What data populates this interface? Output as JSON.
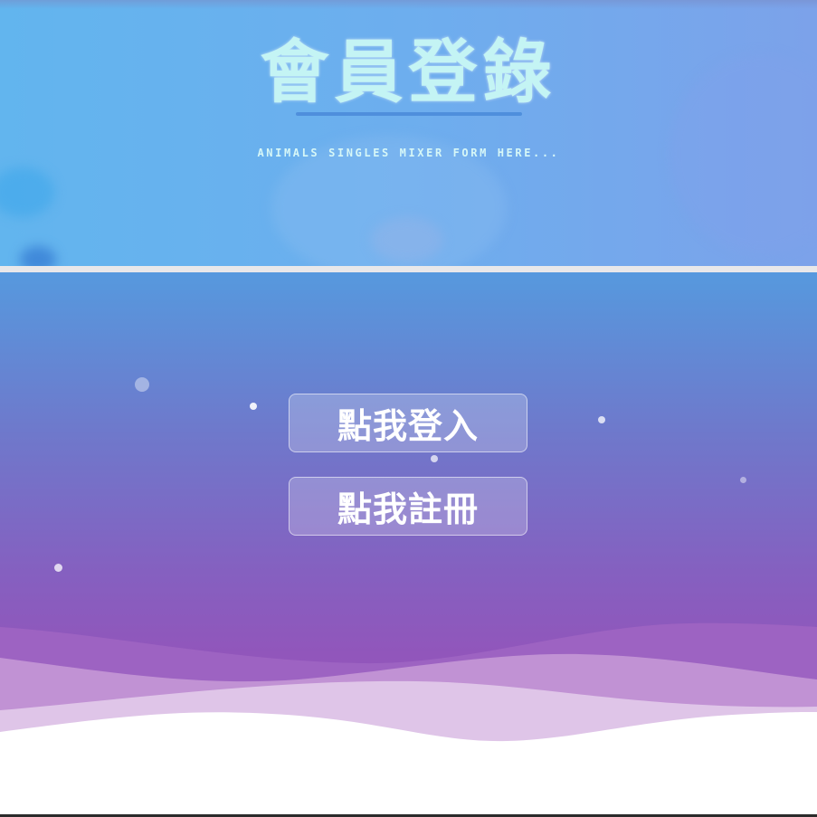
{
  "header": {
    "title": "會員登錄",
    "subtitle": "Animals Singles Mixer Form Here..."
  },
  "actions": {
    "login_label": "點我登入",
    "register_label": "點我註冊"
  },
  "colors": {
    "header_start": "#62b5ee",
    "header_end": "#7ca2ea",
    "title_color": "#c4f4f4",
    "divider": "#4f8fdc",
    "main_top": "#5699de",
    "main_bottom": "#9a55bc",
    "button_text": "#ffffff"
  },
  "decor": {
    "header_background": "blurred-pet-photo",
    "sparkles": "floating-white-dots",
    "footer": "layered-purple-waves"
  }
}
